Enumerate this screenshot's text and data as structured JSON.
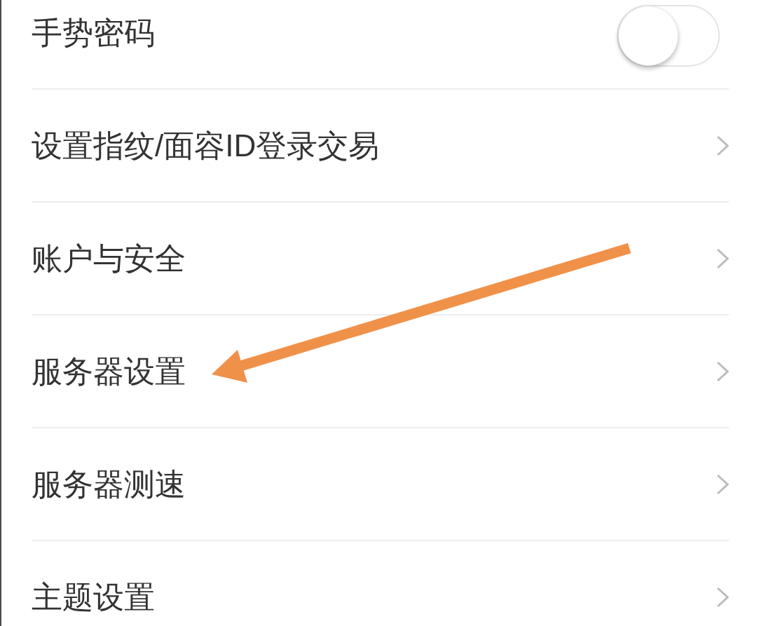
{
  "settings_rows": [
    {
      "kind": "toggle",
      "label": "手势密码",
      "on": false,
      "marked": false
    },
    {
      "kind": "link",
      "label": "设置指纹/面容ID登录交易",
      "marked": false
    },
    {
      "kind": "link",
      "label": "账户与安全",
      "marked": false
    },
    {
      "kind": "link",
      "label": "服务器设置",
      "marked": true
    },
    {
      "kind": "link",
      "label": "服务器测速",
      "marked": false
    },
    {
      "kind": "link",
      "label": "主题设置",
      "marked": false
    }
  ]
}
